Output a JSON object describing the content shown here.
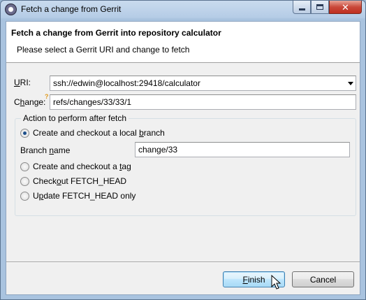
{
  "window": {
    "title": "Fetch a change from Gerrit",
    "close_glyph": "✕"
  },
  "header": {
    "title": "Fetch a change from Gerrit into repository calculator",
    "subtitle": "Please select a Gerrit URI and change to fetch"
  },
  "form": {
    "uri_label_u": "U",
    "uri_label_rest": "RI:",
    "uri_value": "ssh://edwin@localhost:29418/calculator",
    "change_label_pre": "C",
    "change_label_u": "h",
    "change_label_rest": "ange:",
    "change_value": "refs/changes/33/33/1"
  },
  "action_group": {
    "title": "Action to perform after fetch",
    "options": [
      {
        "pre": "Create and checkout a local ",
        "u": "b",
        "post": "ranch",
        "checked": true
      },
      {
        "pre": "Create and checkout a ",
        "u": "t",
        "post": "ag",
        "checked": false
      },
      {
        "pre": "Check",
        "u": "o",
        "post": "ut FETCH_HEAD",
        "checked": false
      },
      {
        "pre": "U",
        "u": "p",
        "post": "date FETCH_HEAD only",
        "checked": false
      }
    ],
    "branch_label_pre": "Branch ",
    "branch_label_u": "n",
    "branch_label_post": "ame",
    "branch_value": "change/33"
  },
  "buttons": {
    "finish_u": "F",
    "finish_rest": "inish",
    "cancel": "Cancel"
  }
}
